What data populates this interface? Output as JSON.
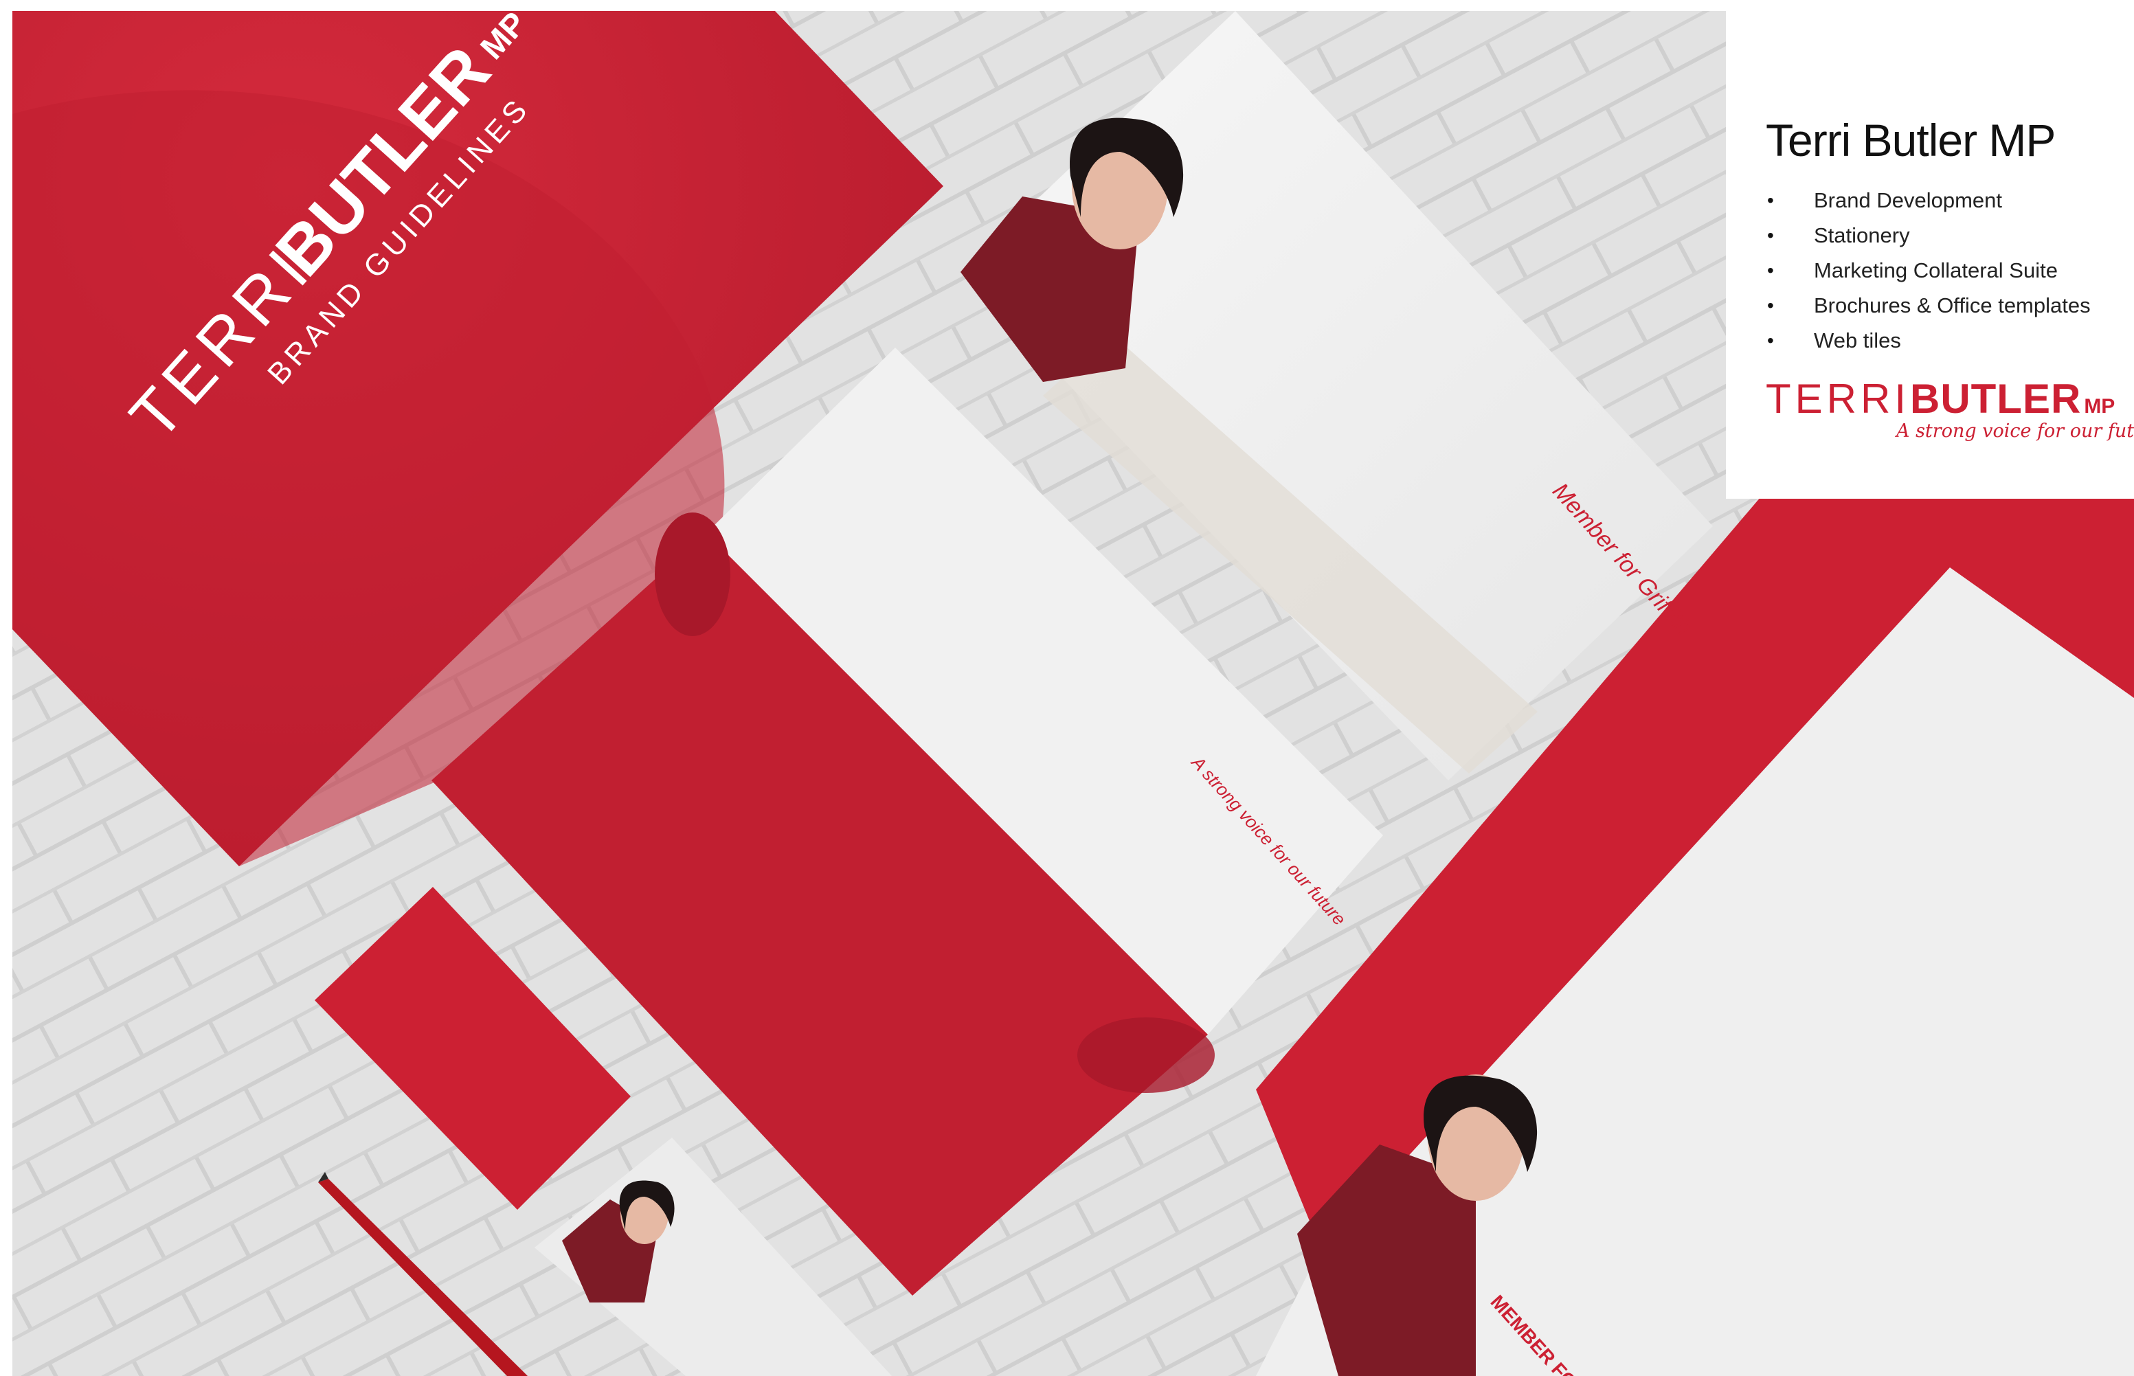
{
  "panel": {
    "title": "Terri Butler MP",
    "services": [
      "Brand Development",
      "Stationery",
      "Marketing Collateral Suite",
      "Brochures & Office templates",
      "Web tiles"
    ],
    "logo_terri": "TERRI",
    "logo_butler": "BUTLER",
    "logo_mp": "MP",
    "tagline": "A strong voice for our future"
  },
  "mockup": {
    "cover_name_terri": "TERRI",
    "cover_name_butler": "BUTLER",
    "cover_name_mp": "MP",
    "cover_subtitle": "BRAND GUIDELINES",
    "letterhead_sign": "Member for Griffith",
    "folder_tagline": "A strong voice for our future",
    "lower_sheet_heading": "MEMBER FOR GR"
  },
  "colors": {
    "brand_red": "#cc2033",
    "dark_red": "#a8182a",
    "brick_white": "#e4e4e4",
    "paper": "#f2f2f2"
  }
}
